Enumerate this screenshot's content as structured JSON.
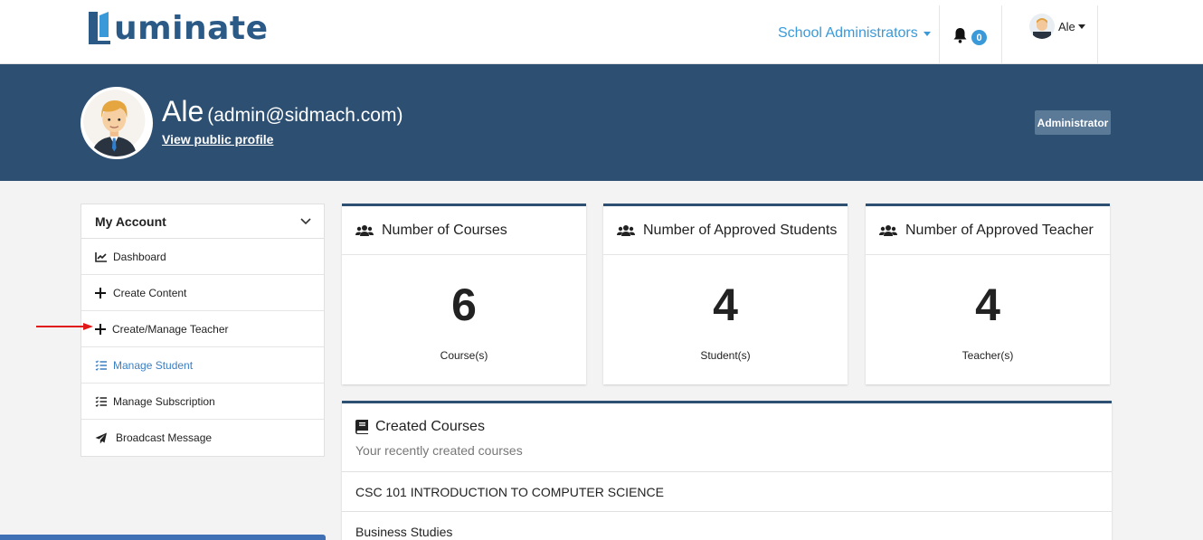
{
  "app": {
    "logo_text": "uminate",
    "brand_color": "#2c5a86",
    "accent_color": "#3a9ad9"
  },
  "topnav": {
    "role_menu": "School Administrators",
    "notification_count": "0",
    "user_name": "Ale"
  },
  "profile": {
    "name": "Ale",
    "email": "(admin@sidmach.com)",
    "public_link": "View public profile",
    "role_tag": "Administrator"
  },
  "sidebar": {
    "header": "My Account",
    "items": [
      {
        "label": "Dashboard",
        "icon": "chart-line-icon"
      },
      {
        "label": "Create Content",
        "icon": "plus-icon"
      },
      {
        "label": "Create/Manage Teacher",
        "icon": "plus-icon"
      },
      {
        "label": "Manage Student",
        "icon": "list-check-icon",
        "active": true
      },
      {
        "label": "Manage Subscription",
        "icon": "list-check-icon"
      },
      {
        "label": "Broadcast Message",
        "icon": "paper-plane-icon"
      }
    ]
  },
  "stats": [
    {
      "title": "Number of Courses",
      "value": "6",
      "unit": "Course(s)",
      "icon": "users-icon"
    },
    {
      "title": "Number of Approved Students",
      "value": "4",
      "unit": "Student(s)",
      "icon": "users-icon"
    },
    {
      "title": "Number of Approved Teacher",
      "value": "4",
      "unit": "Teacher(s)",
      "icon": "users-icon"
    }
  ],
  "created_courses": {
    "title": "Created Courses",
    "subtitle": "Your recently created courses",
    "items": [
      "CSC 101 INTRODUCTION TO COMPUTER SCIENCE",
      "Business Studies"
    ]
  }
}
